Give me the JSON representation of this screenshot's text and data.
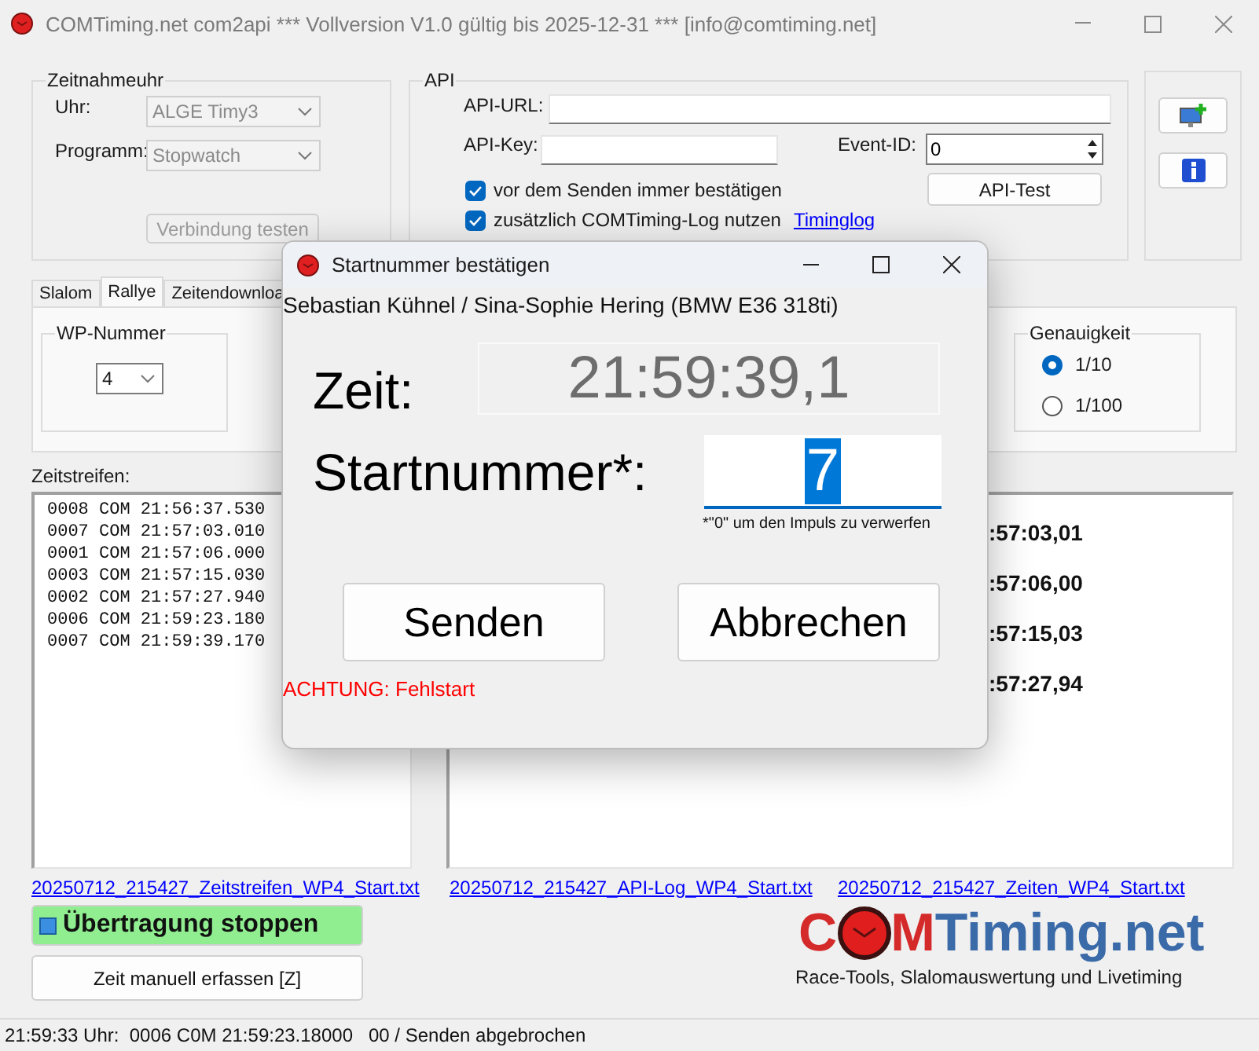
{
  "window": {
    "title": "COMTiming.net com2api *** Vollversion V1.0 gültig bis 2025-12-31 *** [info@comtiming.net]"
  },
  "clock_group": {
    "title": "Zeitnahmeuhr",
    "fields": [
      {
        "label": "Uhr:",
        "value": "ALGE Timy3",
        "disabled": true
      },
      {
        "label": "Programm:",
        "value": "Stopwatch",
        "disabled": true
      }
    ],
    "test_button": {
      "label": "Verbindung testen",
      "disabled": true
    }
  },
  "api_group": {
    "title": "API",
    "url_label": "API-URL:",
    "key_label": "API-Key:",
    "event_label": "Event-ID:",
    "event_value": "0",
    "options": [
      {
        "label": "vor dem Senden immer bestätigen",
        "checked": true
      },
      {
        "label": "zusätzlich COMTiming-Log nutzen",
        "checked": true,
        "link": "Timinglog"
      }
    ],
    "test_button": "API-Test"
  },
  "tabs": [
    {
      "label": "Slalom",
      "selected": false
    },
    {
      "label": "Rallye",
      "selected": true
    },
    {
      "label": "Zeitendownloa",
      "selected": false
    }
  ],
  "wp_group": {
    "title": "WP-Nummer",
    "value": "4"
  },
  "precision_group": {
    "title": "Genauigkeit",
    "options": [
      {
        "label": "1/10",
        "selected": true
      },
      {
        "label": "1/100",
        "selected": false
      }
    ]
  },
  "time_strip": {
    "label": "Zeitstreifen:",
    "lines": [
      "0008 COM 21:56:37.530",
      "0007 COM 21:57:03.010",
      "0001 COM 21:57:06.000",
      "0003 COM 21:57:15.030",
      "0002 COM 21:57:27.940",
      "0006 COM 21:59:23.180",
      "0007 COM 21:59:39.170"
    ]
  },
  "times_list": [
    ":57:03,01",
    ":57:06,00",
    ":57:15,03",
    ":57:27,94"
  ],
  "files": [
    "20250712_215427_Zeitstreifen_WP4_Start.txt",
    "20250712_215427_API-Log_WP4_Start.txt",
    "20250712_215427_Zeiten_WP4_Start.txt"
  ],
  "stop_button": "Übertragung stoppen",
  "manual_button": "Zeit manuell erfassen [Z]",
  "logo": {
    "first": "C",
    "second": "M",
    "rest": "Timing.net",
    "tagline": "Race-Tools, Slalomauswertung und Livetiming"
  },
  "status_bar": "21:59:33 Uhr:  0006 C0M 21:59:23.18000   00 / Senden abgebrochen",
  "dialog": {
    "title": "Startnummer bestätigen",
    "driver": "Sebastian Kühnel / Sina-Sophie Hering (BMW E36 318ti)",
    "time_label": "Zeit:",
    "time": "21:59:39,1",
    "number_label": "Startnummer*:",
    "number": "7",
    "hint": "*\"0\" um den Impuls zu verwerfen",
    "buttons": [
      "Senden",
      "Abbrechen"
    ],
    "warning": "ACHTUNG: Fehlstart"
  }
}
